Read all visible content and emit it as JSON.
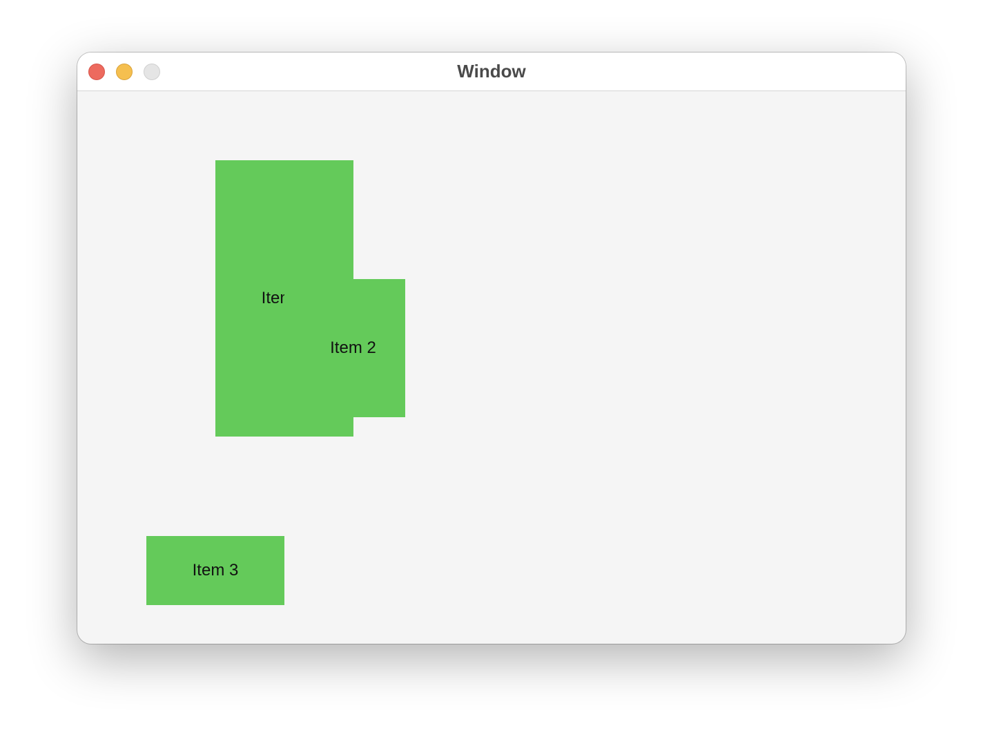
{
  "window": {
    "title": "Window",
    "controls": [
      "close",
      "minimize",
      "zoom"
    ]
  },
  "items": [
    {
      "label": "Item"
    },
    {
      "label": "Item 2"
    },
    {
      "label": "Item 3"
    }
  ],
  "colors": {
    "item_fill": "#64ca5a",
    "content_background": "#f5f5f5",
    "close": "#ed6a5e",
    "minimize": "#f5bf4f",
    "zoom": "#e5e5e5"
  }
}
